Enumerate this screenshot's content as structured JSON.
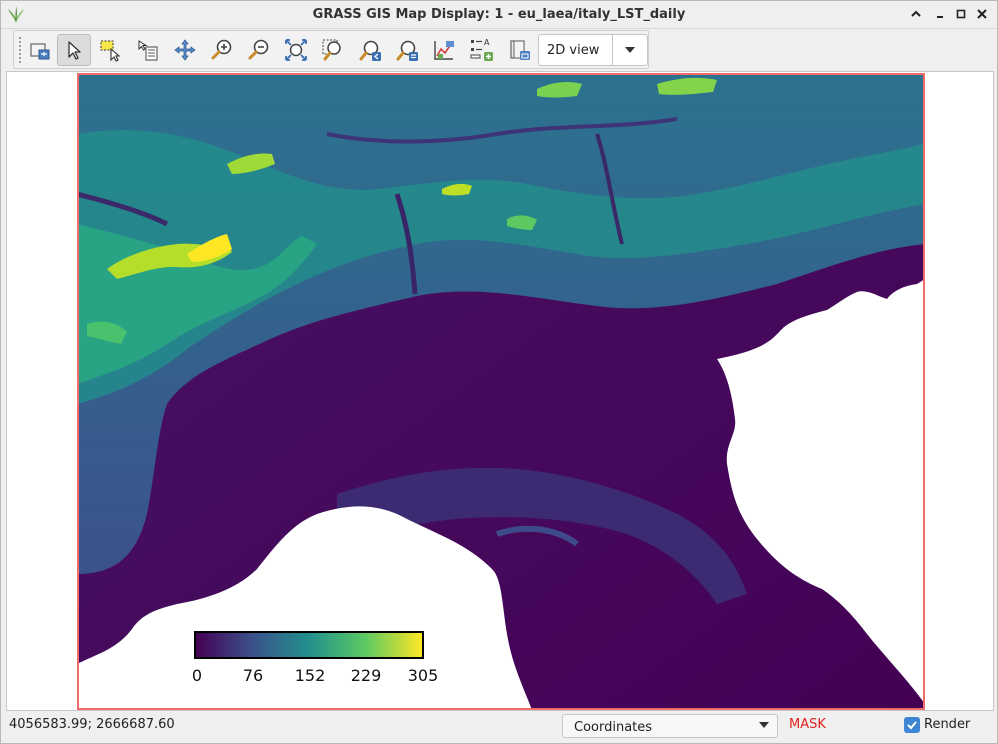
{
  "window": {
    "title": "GRASS GIS Map Display: 1 - eu_laea/italy_LST_daily"
  },
  "toolbar": {
    "buttons": [
      {
        "icon": "layer-manager-icon"
      },
      {
        "icon": "pointer-icon",
        "active": true
      },
      {
        "icon": "select-icon"
      },
      {
        "icon": "query-icon"
      },
      {
        "icon": "pan-icon"
      },
      {
        "icon": "zoom-in-icon"
      },
      {
        "icon": "zoom-out-icon"
      },
      {
        "icon": "zoom-extent-icon"
      },
      {
        "icon": "zoom-region-icon"
      },
      {
        "icon": "zoom-back-icon"
      },
      {
        "icon": "zoom-menu-icon"
      },
      {
        "icon": "analyze-icon"
      },
      {
        "icon": "decorations-icon"
      },
      {
        "icon": "save-image-icon"
      }
    ],
    "view_mode": "2D view"
  },
  "map": {
    "legend": {
      "ticks": [
        "0",
        "76",
        "152",
        "229",
        "305"
      ],
      "colors": [
        "#440154",
        "#3b518b",
        "#21908d",
        "#5dc962",
        "#fde725"
      ]
    },
    "region_frame_color": "#f26b6b",
    "nodata_color": "#ffffff"
  },
  "statusbar": {
    "coordinates": "4056583.99; 2666687.60",
    "mode": "Coordinates",
    "mask": "MASK",
    "render_label": "Render",
    "render_checked": true
  }
}
